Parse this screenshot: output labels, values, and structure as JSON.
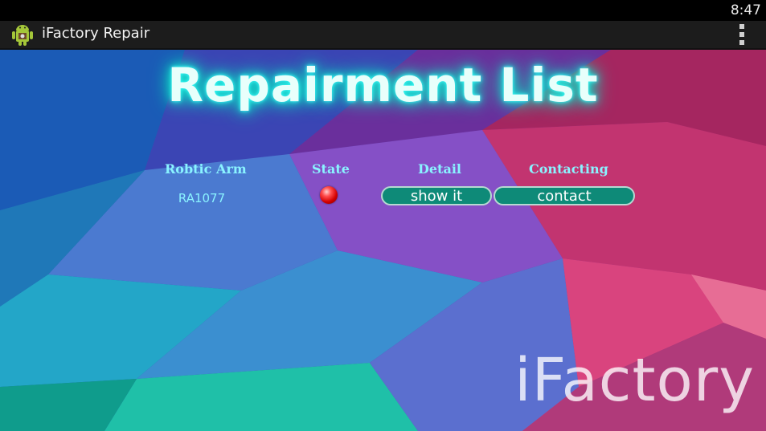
{
  "status_bar": {
    "time": "8:47"
  },
  "action_bar": {
    "title": "iFactory Repair",
    "app_icon": "android-robot-icon",
    "overflow_icon": "overflow-menu-icon"
  },
  "page": {
    "title": "Repairment List",
    "watermark": "iFactory"
  },
  "table": {
    "headers": [
      "Robtic Arm",
      "State",
      "Detail",
      "Contacting"
    ],
    "rows": [
      {
        "robotic_arm": "RA1077",
        "state": "red-status-icon",
        "detail_button": "show it",
        "contact_button": "contact"
      }
    ]
  },
  "colors": {
    "title_glow": "#1de6d8",
    "header_text": "#8af3ff",
    "button_bg": "#0e8a78",
    "state_red": "#d30000"
  }
}
